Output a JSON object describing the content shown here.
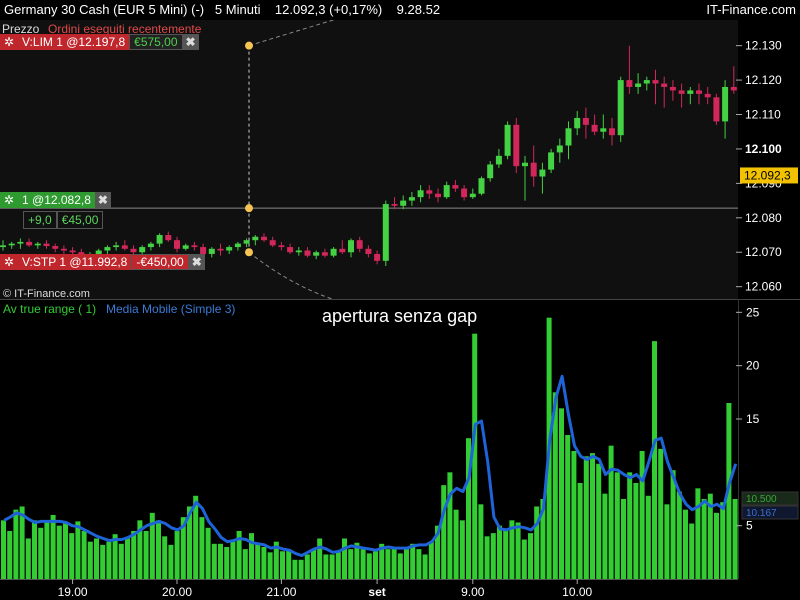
{
  "header": {
    "title": "Germany 30 Cash (EUR 5 Mini) (-)   5 Minuti    12.092,3 (+0,17%)    9.28.52",
    "brand": "IT-Finance.com"
  },
  "price_panel": {
    "label": "Prezzo",
    "recent_orders": "Ordini eseguiti recentemente",
    "watermark": "© IT-Finance.com",
    "y_ticks": [
      "12.130",
      "12.120",
      "12.110",
      "12.100",
      "12.090",
      "12.080",
      "12.070",
      "12.060"
    ],
    "y_tick_values": [
      12130,
      12120,
      12110,
      12100,
      12090,
      12080,
      12070,
      12060
    ],
    "y_range": [
      12057,
      12136
    ],
    "current_price_label": "12.092,3",
    "current_price": 12092.3,
    "colors": {
      "up": "#44d144",
      "down": "#d1275a",
      "background": "#101010",
      "position_line": "#888888"
    }
  },
  "orders": {
    "limit": {
      "label": "V:LIM 1 @12.197,8",
      "pnl": "€575,00",
      "price": 12130
    },
    "position": {
      "label": "1 @12.082,8",
      "points": "+9,0",
      "pnl": "€45,00",
      "price": 12082.8
    },
    "stop": {
      "label": "V:STP 1 @11.992,8",
      "pnl": "-€450,00",
      "price": 12070
    }
  },
  "indicator_panel": {
    "legend_atr": "Av true range ( 1)",
    "legend_ma": "Media Mobile (Simple 3)",
    "annotation": "apertura senza gap",
    "y_ticks": [
      "25",
      "20",
      "15",
      "5"
    ],
    "y_tick_values": [
      25,
      20,
      15,
      5
    ],
    "y_range": [
      0,
      25.5
    ],
    "badge_atr": "10.500",
    "badge_ma": "10.167",
    "colors": {
      "atr": "#33cc33",
      "ma": "#1e64d8"
    }
  },
  "x_axis": {
    "labels": [
      "19.00",
      "20.00",
      "21.00",
      "set",
      "9.00",
      "10.00"
    ],
    "label_index": [
      8,
      20,
      32,
      43,
      54,
      66
    ]
  },
  "chart_data": [
    {
      "type": "candlestick",
      "title": "Germany 30 Cash (EUR 5 Mini)",
      "timeframe": "5 Minuti",
      "ohlc": [
        [
          12071.5,
          12073.5,
          12070.5,
          12072
        ],
        [
          12072,
          12073,
          12071,
          12072.5
        ],
        [
          12072.5,
          12074,
          12071,
          12073
        ],
        [
          12073,
          12074,
          12071.5,
          12072
        ],
        [
          12072,
          12073,
          12071,
          12072.5
        ],
        [
          12072.5,
          12073.5,
          12071,
          12071.8
        ],
        [
          12071.8,
          12072.5,
          12070,
          12071
        ],
        [
          12071,
          12072,
          12069.5,
          12070.5
        ],
        [
          12070.5,
          12071.5,
          12069,
          12070
        ],
        [
          12070,
          12071,
          12067.5,
          12068.5
        ],
        [
          12068.5,
          12070,
          12067,
          12069.5
        ],
        [
          12069.5,
          12071,
          12068.5,
          12070.5
        ],
        [
          12070.5,
          12072,
          12069.5,
          12071.5
        ],
        [
          12071.5,
          12073,
          12070.5,
          12072
        ],
        [
          12072,
          12073.5,
          12070.5,
          12071
        ],
        [
          12071,
          12072,
          12069.5,
          12070
        ],
        [
          12070,
          12072,
          12069.5,
          12071.5
        ],
        [
          12071.5,
          12073,
          12070.5,
          12072.5
        ],
        [
          12072.5,
          12075.5,
          12071.5,
          12075
        ],
        [
          12075,
          12076,
          12073,
          12073.5
        ],
        [
          12073.5,
          12074.5,
          12070,
          12071
        ],
        [
          12071,
          12072.5,
          12070.5,
          12072
        ],
        [
          12072,
          12073,
          12070.5,
          12071.5
        ],
        [
          12071.5,
          12072.5,
          12068.5,
          12069.5
        ],
        [
          12069.5,
          12071.5,
          12068.5,
          12071
        ],
        [
          12071,
          12072.5,
          12069,
          12070.5
        ],
        [
          12070.5,
          12072,
          12069.5,
          12071.5
        ],
        [
          12071.5,
          12073,
          12070.5,
          12072.5
        ],
        [
          12072.5,
          12074,
          12071.5,
          12073.5
        ],
        [
          12073.5,
          12075,
          12072,
          12074.5
        ],
        [
          12074.5,
          12075.5,
          12073,
          12073.5
        ],
        [
          12073.5,
          12074.5,
          12071.5,
          12072
        ],
        [
          12072,
          12073,
          12070.5,
          12071.5
        ],
        [
          12071.5,
          12072.5,
          12069.5,
          12070
        ],
        [
          12070,
          12071.5,
          12069,
          12070.5
        ],
        [
          12070.5,
          12071.5,
          12068.5,
          12069
        ],
        [
          12069,
          12070.5,
          12068,
          12070
        ],
        [
          12070,
          12071,
          12068.5,
          12069
        ],
        [
          12069,
          12071.5,
          12068.5,
          12071
        ],
        [
          12071,
          12073.5,
          12069.5,
          12070
        ],
        [
          12070,
          12074,
          12068.5,
          12073.5
        ],
        [
          12073.5,
          12074.5,
          12070,
          12071
        ],
        [
          12071,
          12072,
          12068.5,
          12069.5
        ],
        [
          12069.5,
          12070.5,
          12066.5,
          12067.5
        ],
        [
          12067.5,
          12085,
          12066,
          12084
        ],
        [
          12084,
          12086,
          12082.5,
          12083.5
        ],
        [
          12083.5,
          12086.5,
          12082.5,
          12085
        ],
        [
          12085,
          12087.5,
          12083.5,
          12086
        ],
        [
          12086,
          12089.5,
          12084.5,
          12088
        ],
        [
          12088,
          12089.5,
          12085.5,
          12087
        ],
        [
          12087,
          12088.5,
          12084.5,
          12086
        ],
        [
          12086,
          12090.5,
          12085.5,
          12089.5
        ],
        [
          12089.5,
          12091,
          12087.5,
          12088.5
        ],
        [
          12088.5,
          12089.5,
          12085,
          12086
        ],
        [
          12086,
          12088.5,
          12085.5,
          12087
        ],
        [
          12087,
          12092,
          12086.5,
          12091.5
        ],
        [
          12091.5,
          12096.5,
          12090.5,
          12095.5
        ],
        [
          12095.5,
          12100,
          12094.5,
          12098
        ],
        [
          12098,
          12108,
          12097,
          12107
        ],
        [
          12107,
          12109,
          12093,
          12095
        ],
        [
          12095,
          12098,
          12085,
          12096
        ],
        [
          12096,
          12101,
          12089,
          12092
        ],
        [
          12092,
          12096,
          12087,
          12094
        ],
        [
          12094,
          12100,
          12093,
          12099
        ],
        [
          12099,
          12103,
          12096,
          12101
        ],
        [
          12101,
          12108,
          12097,
          12106
        ],
        [
          12106,
          12111,
          12104,
          12109
        ],
        [
          12109,
          12112,
          12103,
          12107
        ],
        [
          12107,
          12110,
          12104,
          12105
        ],
        [
          12105,
          12110,
          12103,
          12106
        ],
        [
          12106,
          12109,
          12101,
          12104
        ],
        [
          12104,
          12121,
          12102,
          12120
        ],
        [
          12120,
          12130,
          12116,
          12118
        ],
        [
          12118,
          12122,
          12116,
          12119
        ],
        [
          12119,
          12121,
          12117,
          12120
        ],
        [
          12120,
          12123,
          12113,
          12119
        ],
        [
          12119,
          12121,
          12112,
          12118
        ],
        [
          12118,
          12120,
          12114,
          12117
        ],
        [
          12117,
          12119,
          12112,
          12116
        ],
        [
          12116,
          12118,
          12113,
          12117
        ],
        [
          12117,
          12119,
          12113,
          12116
        ],
        [
          12116,
          12118,
          12113,
          12115
        ],
        [
          12115,
          12116,
          12107,
          12108
        ],
        [
          12108,
          12120,
          12103,
          12118
        ],
        [
          12118,
          12124,
          12116,
          12117
        ]
      ]
    },
    {
      "type": "bar",
      "series": [
        {
          "name": "Av true range ( 1)",
          "values": [
            5.5,
            4.5,
            6.5,
            6.8,
            3.8,
            5.5,
            4.8,
            5.5,
            6,
            5,
            5.2,
            4.3,
            5.4,
            4.5,
            3.5,
            3.8,
            3.2,
            3.5,
            4.2,
            3.3,
            3.8,
            4.5,
            5.5,
            4.5,
            6.2,
            5.5,
            4,
            3.2,
            4.5,
            5.8,
            6.8,
            7.8,
            5.8,
            4.8,
            3.3,
            3.3,
            3,
            3.5,
            4.5,
            2.8,
            4.3,
            3.3,
            3,
            2.5,
            3.5,
            2.6,
            2.8,
            1.8,
            1.8,
            2.3,
            2.8,
            3.8,
            2.3,
            2.3,
            2.5,
            3.8,
            2.8,
            3.4,
            2.8,
            2.4,
            2.6,
            3.3,
            2.8,
            2.8,
            2.4,
            2.8,
            3.3,
            2.8,
            2.3,
            3.5,
            5,
            8.8,
            10,
            6.5,
            5.5,
            13.2,
            23,
            7,
            4,
            4.3,
            5,
            4.5,
            5.5,
            5.3,
            3.7,
            4.3,
            6.8,
            7.5,
            24.5,
            17.5,
            16,
            13.5,
            12,
            9,
            11.5,
            11.8,
            10.8,
            8,
            12.5,
            10,
            7.5,
            10,
            9,
            12,
            7.8,
            22.3,
            12.2,
            7,
            10.2,
            8.2,
            6.5,
            5.2,
            8.5,
            7.5,
            8,
            6.2,
            7.2,
            16.5,
            7.5
          ]
        },
        {
          "name": "Media Mobile (Simple 3)",
          "type": "line",
          "values": [
            5.5,
            5.8,
            6.2,
            6,
            5.6,
            5.3,
            5.4,
            5.4,
            5.4,
            5.4,
            5.3,
            5,
            4.9,
            4.6,
            4.3,
            4,
            3.8,
            3.6,
            3.7,
            3.7,
            3.9,
            4.2,
            4.6,
            5,
            5.2,
            5.4,
            5.2,
            4.8,
            4.6,
            5,
            6.2,
            7.2,
            6.6,
            5.4,
            4.7,
            3.9,
            3.5,
            3.6,
            3.8,
            3.7,
            3.4,
            3.3,
            3.2,
            2.9,
            3,
            2.8,
            2.7,
            2.4,
            2.2,
            2.5,
            2.8,
            3,
            2.8,
            2.5,
            2.6,
            2.9,
            3.1,
            3,
            2.9,
            2.8,
            2.7,
            2.9,
            3,
            2.9,
            2.9,
            2.9,
            3.1,
            3.2,
            3.2,
            3.5,
            4.3,
            6.5,
            8,
            8.5,
            8.2,
            9.5,
            14.5,
            14.8,
            11,
            5.8,
            4.7,
            4.6,
            4.8,
            4.9,
            4.8,
            4.6,
            5.2,
            6.6,
            13,
            17,
            19,
            15.5,
            12.5,
            11.5,
            11.2,
            11.5,
            11.2,
            9.8,
            10.3,
            10.2,
            9.8,
            9.5,
            9.8,
            9.2,
            11,
            13,
            13.2,
            11,
            9.5,
            8,
            7,
            6.5,
            6.8,
            7.3,
            6.8,
            7,
            6.6,
            9,
            10.8
          ]
        }
      ]
    }
  ]
}
